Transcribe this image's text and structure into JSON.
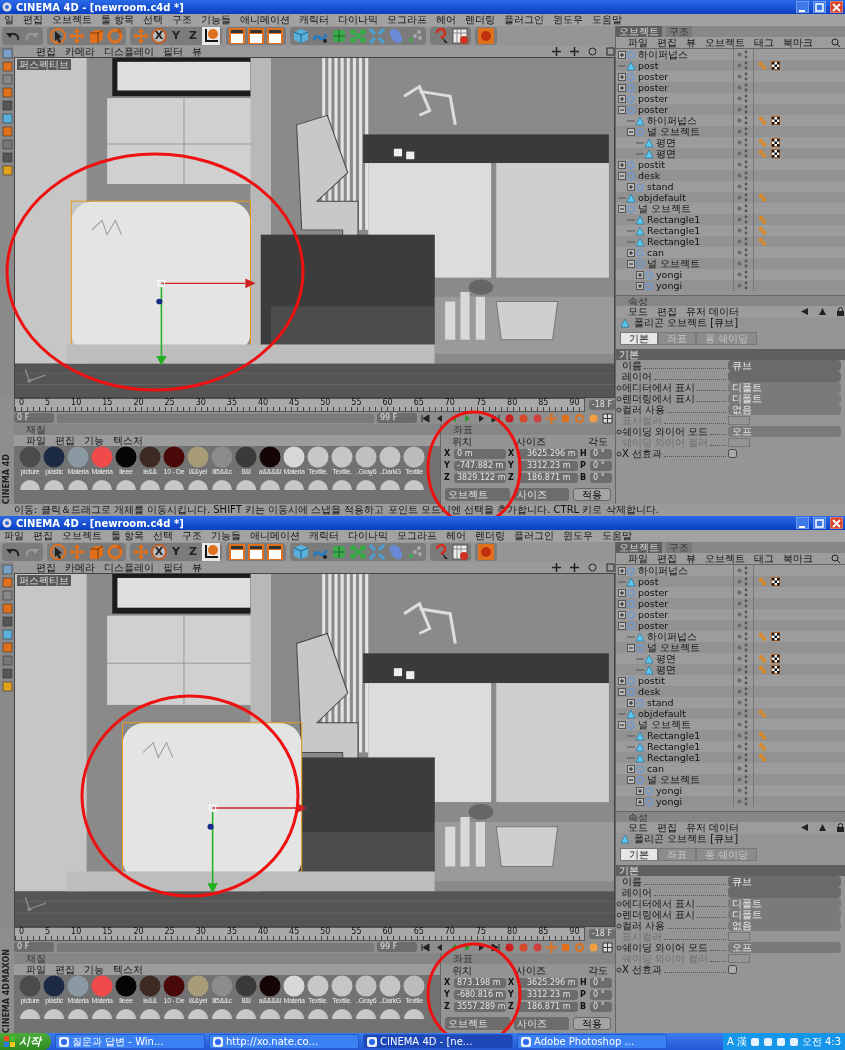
{
  "windows": [
    {
      "title": "CINEMA 4D - [newroom.c4d *]",
      "menu": [
        "일",
        "편집",
        "오브젝트",
        "툴 항목",
        "선택",
        "구조",
        "기능들",
        "애니메이션",
        "캐릭터",
        "다이나믹",
        "모그라프",
        "헤어",
        "렌더링",
        "플러그인",
        "윈도우",
        "도움말"
      ],
      "toolbar": {
        "letters": [
          "X",
          "Y",
          "Z"
        ]
      },
      "viewport": {
        "menu": [
          "편집",
          "카메라",
          "디스플레이",
          "필터",
          "뷰"
        ],
        "label": "퍼스펙티브"
      },
      "timeline": {
        "ticks": [
          "0",
          "5",
          "10",
          "15",
          "20",
          "25",
          "30",
          "35",
          "40",
          "45",
          "50",
          "55",
          "60",
          "65",
          "70",
          "75",
          "80",
          "85",
          "90"
        ],
        "end_marker": "-18 F",
        "start_field": "0 F",
        "end_field": "99 F",
        "range": {
          "level": 1
        }
      },
      "materials": {
        "title": "재질",
        "menu": [
          "파일",
          "편집",
          "기능",
          "텍스처"
        ],
        "items": [
          {
            "name": "picture",
            "color": "#4b4b4b"
          },
          {
            "name": "plastic",
            "color": "#1c2a44"
          },
          {
            "name": "Materia",
            "color": "#8b99a3"
          },
          {
            "name": "Materia",
            "color": "#f04a4a"
          },
          {
            "name": "lleee",
            "color": "#050505"
          },
          {
            "name": "le&&",
            "color": "#3d2a22"
          },
          {
            "name": "10 - De",
            "color": "#4a0a0a"
          },
          {
            "name": "l&&yel",
            "color": "#a89c78"
          },
          {
            "name": "lll5&&c",
            "color": "#8c8c8c"
          },
          {
            "name": "8&l",
            "color": "#3a3a3a"
          },
          {
            "name": "a&&&&l",
            "color": "#150505"
          },
          {
            "name": "Materia",
            "color": "#d8d8d8"
          },
          {
            "name": "Textile.",
            "color": "#c8c8c8"
          },
          {
            "name": "Textile.",
            "color": "#c6c6c6"
          },
          {
            "name": "..Gray6",
            "color": "#c0c0c0"
          },
          {
            "name": "..DarkG",
            "color": "#c4c4c4"
          },
          {
            "name": "Textile",
            "color": "#bcbcbc"
          }
        ]
      },
      "brand": [
        "CINEMA 4D"
      ],
      "coordinates": {
        "title": "좌표",
        "headers": [
          "위치",
          "사이즈",
          "각도"
        ],
        "rows": [
          {
            "axis": "X",
            "position": "0 m",
            "size_axis": "X",
            "size": "3625.296 m",
            "angle_axis": "H",
            "angle": "0 °"
          },
          {
            "axis": "Y",
            "position": "-747.882 m",
            "size_axis": "Y",
            "size": "3312.23 m",
            "angle_axis": "P",
            "angle": "0 °"
          },
          {
            "axis": "Z",
            "position": "3829.122 m",
            "size_axis": "Z",
            "size": "186.871 m",
            "angle_axis": "B",
            "angle": "0 °"
          }
        ],
        "modes": [
          "오브젝트",
          "사이즈"
        ],
        "apply": "적용"
      },
      "status": "이동: 클릭＆드래그로 개체를 이동시킵니다. SHIFT 키는 이동시에 스냅을 적용하고 포인트 모드시엔 선택을 추가합니다. CTRL 키로 삭제합니다.",
      "object_manager": {
        "tabs": [
          {
            "label": "오브젝트",
            "selected": true
          },
          {
            "label": "구조",
            "selected": false
          }
        ],
        "menu": [
          "파일",
          "편집",
          "뷰",
          "오브젝트",
          "태그",
          "북마크"
        ],
        "tree": [
          {
            "name": "하이퍼넙스",
            "kind": "null",
            "expanded": false
          },
          {
            "name": "post",
            "kind": "polygon",
            "phong_tag": true,
            "texture_tag": true
          },
          {
            "name": "poster",
            "kind": "null",
            "expanded": false
          },
          {
            "name": "poster",
            "kind": "null",
            "expanded": false
          },
          {
            "name": "poster",
            "kind": "null",
            "expanded": false
          },
          {
            "name": "poster",
            "kind": "null",
            "expanded": true,
            "children": [
              {
                "name": "하이퍼넙스",
                "kind": "polygon",
                "phong_tag": true,
                "texture_tag": true
              },
              {
                "name": "널 오브젝트",
                "kind": "null",
                "expanded": true,
                "children": [
                  {
                    "name": "평면",
                    "kind": "polygon",
                    "phong_tag": true,
                    "texture_tag": true
                  },
                  {
                    "name": "평면",
                    "kind": "polygon",
                    "phong_tag": true,
                    "texture_tag": true
                  }
                ]
              }
            ]
          },
          {
            "name": "postit",
            "kind": "null",
            "expanded": false
          },
          {
            "name": "desk",
            "kind": "null",
            "expanded": true,
            "children": [
              {
                "name": "stand",
                "kind": "null",
                "expanded": false
              }
            ]
          },
          {
            "name": "objdefault",
            "kind": "polygon",
            "phong_tag": true
          },
          {
            "name": "널 오브젝트",
            "kind": "null",
            "expanded": true,
            "children": [
              {
                "name": "Rectangle1",
                "kind": "polygon",
                "phong_tag": true
              },
              {
                "name": "Rectangle1",
                "kind": "polygon",
                "phong_tag": true
              },
              {
                "name": "Rectangle1",
                "kind": "polygon",
                "phong_tag": true
              },
              {
                "name": "can",
                "kind": "null",
                "expanded": false
              },
              {
                "name": "널 오브젝트",
                "kind": "null",
                "expanded": true,
                "children": [
                  {
                    "name": "yongi",
                    "kind": "null",
                    "expanded": false
                  },
                  {
                    "name": "yongi",
                    "kind": "null",
                    "expanded": false
                  }
                ]
              }
            ]
          }
        ]
      },
      "attributes": {
        "title": "속성",
        "menu": [
          "모드",
          "편집",
          "유저 데이터"
        ],
        "object": "폴리곤 오브젝트 [큐브]",
        "tabs": [
          {
            "label": "기본",
            "selected": true
          },
          {
            "label": "좌표",
            "selected": false
          },
          {
            "label": "퐁 쉐이딩",
            "selected": false
          }
        ],
        "section": "기본",
        "fields": [
          {
            "kind": "text",
            "label": "이름",
            "value": "큐브",
            "animatable": false,
            "disabled": false
          },
          {
            "kind": "link",
            "label": "레이어",
            "animatable": false,
            "disabled": false
          },
          {
            "kind": "dropdown",
            "label": "에디터에서 표시",
            "value": "디폴트",
            "animatable": true,
            "disabled": false
          },
          {
            "kind": "dropdown",
            "label": "렌더링에서 표시",
            "value": "디폴트",
            "animatable": true,
            "disabled": false
          },
          {
            "kind": "dropdown",
            "label": "컬러 사용",
            "value": "없음",
            "animatable": true,
            "disabled": false
          },
          {
            "kind": "color",
            "label": "표시컬러",
            "animatable": false,
            "disabled": true
          },
          {
            "kind": "dropdown",
            "label": "쉐이딩 와이어 모드",
            "value": "오프",
            "animatable": true,
            "disabled": false
          },
          {
            "kind": "color",
            "label": "쉐이딩 와이어 컬러",
            "animatable": false,
            "disabled": true
          },
          {
            "kind": "checkbox",
            "label": "X 선효과",
            "checked": false,
            "animatable": true,
            "disabled": false
          }
        ]
      }
    },
    {
      "title": "CINEMA 4D - [newroom.c4d *]",
      "menu": [
        "파일",
        "편집",
        "오브젝트",
        "툴 항목",
        "선택",
        "구조",
        "기능들",
        "애니메이션",
        "캐릭터",
        "다이나믹",
        "모그라프",
        "헤어",
        "렌더링",
        "플러그인",
        "윈도우",
        "도움말"
      ],
      "toolbar": {
        "letters": [
          "X",
          "Y",
          "Z"
        ]
      },
      "viewport": {
        "menu": [
          "편집",
          "카메라",
          "디스플레이",
          "필터",
          "뷰"
        ],
        "label": "퍼스펙티브"
      },
      "timeline": {
        "ticks": [
          "0",
          "5",
          "10",
          "15",
          "20",
          "25",
          "30",
          "35",
          "40",
          "45",
          "50",
          "55",
          "60",
          "65",
          "70",
          "75",
          "80",
          "85",
          "90"
        ],
        "end_marker": "-18 F",
        "start_field": "0 F",
        "end_field": "99 F",
        "range": {
          "level": 1
        }
      },
      "materials": {
        "title": "재질",
        "menu": [
          "파일",
          "편집",
          "기능",
          "텍스처"
        ],
        "items": [
          {
            "name": "picture",
            "color": "#4b4b4b"
          },
          {
            "name": "plastic",
            "color": "#1c2a44"
          },
          {
            "name": "Materia",
            "color": "#8b99a3"
          },
          {
            "name": "Materia",
            "color": "#f04a4a"
          },
          {
            "name": "lleee",
            "color": "#050505"
          },
          {
            "name": "le&&",
            "color": "#3d2a22"
          },
          {
            "name": "10 - De",
            "color": "#4a0a0a"
          },
          {
            "name": "l&&yel",
            "color": "#a89c78"
          },
          {
            "name": "lll5&&c",
            "color": "#8c8c8c"
          },
          {
            "name": "8&l",
            "color": "#3a3a3a"
          },
          {
            "name": "a&&&&l",
            "color": "#150505"
          },
          {
            "name": "Materia",
            "color": "#d8d8d8"
          },
          {
            "name": "Textile.",
            "color": "#c8c8c8"
          },
          {
            "name": "Textile.",
            "color": "#c6c6c6"
          },
          {
            "name": "..Gray6",
            "color": "#c0c0c0"
          },
          {
            "name": "..DarkG",
            "color": "#c4c4c4"
          },
          {
            "name": "Textile",
            "color": "#bcbcbc"
          }
        ]
      },
      "brand": [
        "MAXON",
        "CINEMA 4D"
      ],
      "coordinates": {
        "title": "좌표",
        "headers": [
          "위치",
          "사이즈",
          "각도"
        ],
        "rows": [
          {
            "axis": "X",
            "position": "873.198 m",
            "size_axis": "X",
            "size": "3625.296 m",
            "angle_axis": "H",
            "angle": "0 °"
          },
          {
            "axis": "Y",
            "position": "-680.816 m",
            "size_axis": "Y",
            "size": "3312.23 m",
            "angle_axis": "P",
            "angle": "0 °"
          },
          {
            "axis": "Z",
            "position": "3557.289 m",
            "size_axis": "Z",
            "size": "186.871 m",
            "angle_axis": "B",
            "angle": "0 °"
          }
        ],
        "modes": [
          "오브젝트",
          "사이즈"
        ],
        "apply": "적용"
      },
      "object_manager": {
        "tabs": [
          {
            "label": "오브젝트",
            "selected": true
          },
          {
            "label": "구조",
            "selected": false
          }
        ],
        "menu": [
          "파일",
          "편집",
          "뷰",
          "오브젝트",
          "태그",
          "북마크"
        ],
        "tree": [
          {
            "name": "하이퍼넙스",
            "kind": "null",
            "expanded": false
          },
          {
            "name": "post",
            "kind": "polygon",
            "phong_tag": true,
            "texture_tag": true
          },
          {
            "name": "poster",
            "kind": "null",
            "expanded": false
          },
          {
            "name": "poster",
            "kind": "null",
            "expanded": false
          },
          {
            "name": "poster",
            "kind": "null",
            "expanded": false
          },
          {
            "name": "poster",
            "kind": "null",
            "expanded": true,
            "children": [
              {
                "name": "하이퍼넙스",
                "kind": "polygon",
                "phong_tag": true,
                "texture_tag": true
              },
              {
                "name": "널 오브젝트",
                "kind": "null",
                "expanded": true,
                "children": [
                  {
                    "name": "평면",
                    "kind": "polygon",
                    "phong_tag": true,
                    "texture_tag": true
                  },
                  {
                    "name": "평면",
                    "kind": "polygon",
                    "phong_tag": true,
                    "texture_tag": true
                  }
                ]
              }
            ]
          },
          {
            "name": "postit",
            "kind": "null",
            "expanded": false
          },
          {
            "name": "desk",
            "kind": "null",
            "expanded": true,
            "children": [
              {
                "name": "stand",
                "kind": "null",
                "expanded": false
              }
            ]
          },
          {
            "name": "objdefault",
            "kind": "polygon",
            "phong_tag": true
          },
          {
            "name": "널 오브젝트",
            "kind": "null",
            "expanded": true,
            "children": [
              {
                "name": "Rectangle1",
                "kind": "polygon",
                "phong_tag": true
              },
              {
                "name": "Rectangle1",
                "kind": "polygon",
                "phong_tag": true
              },
              {
                "name": "Rectangle1",
                "kind": "polygon",
                "phong_tag": true
              },
              {
                "name": "can",
                "kind": "null",
                "expanded": false
              },
              {
                "name": "널 오브젝트",
                "kind": "null",
                "expanded": true,
                "children": [
                  {
                    "name": "yongi",
                    "kind": "null",
                    "expanded": false
                  },
                  {
                    "name": "yongi",
                    "kind": "null",
                    "expanded": false
                  }
                ]
              }
            ]
          }
        ]
      },
      "attributes": {
        "title": "속성",
        "menu": [
          "모드",
          "편집",
          "유저 데이터"
        ],
        "object": "폴리곤 오브젝트 [큐브]",
        "tabs": [
          {
            "label": "기본",
            "selected": true
          },
          {
            "label": "좌표",
            "selected": false
          },
          {
            "label": "퐁 쉐이딩",
            "selected": false
          }
        ],
        "section": "기본",
        "fields": [
          {
            "kind": "text",
            "label": "이름",
            "value": "큐브",
            "animatable": false,
            "disabled": false
          },
          {
            "kind": "link",
            "label": "레이어",
            "animatable": false,
            "disabled": false
          },
          {
            "kind": "dropdown",
            "label": "에디터에서 표시",
            "value": "디폴트",
            "animatable": true,
            "disabled": false
          },
          {
            "kind": "dropdown",
            "label": "렌더링에서 표시",
            "value": "디폴트",
            "animatable": true,
            "disabled": false
          },
          {
            "kind": "dropdown",
            "label": "컬러 사용",
            "value": "없음",
            "animatable": true,
            "disabled": false
          },
          {
            "kind": "color",
            "label": "표시컬러",
            "animatable": false,
            "disabled": true
          },
          {
            "kind": "dropdown",
            "label": "쉐이딩 와이어 모드",
            "value": "오프",
            "animatable": true,
            "disabled": false
          },
          {
            "kind": "color",
            "label": "쉐이딩 와이어 컬러",
            "animatable": false,
            "disabled": true
          },
          {
            "kind": "checkbox",
            "label": "X 선효과",
            "checked": false,
            "animatable": true,
            "disabled": false
          }
        ]
      }
    }
  ],
  "taskbar": {
    "start": "시작",
    "tasks": [
      {
        "label": "질문과 답변 - Win...",
        "selected": false
      },
      {
        "label": "http://xo.nate.co...",
        "selected": false
      },
      {
        "label": "CINEMA 4D - [ne...",
        "selected": true
      },
      {
        "label": "Adobe Photoshop ...",
        "selected": false
      }
    ],
    "tray": [
      "A",
      "漢"
    ],
    "clock": "오전 4:3"
  }
}
